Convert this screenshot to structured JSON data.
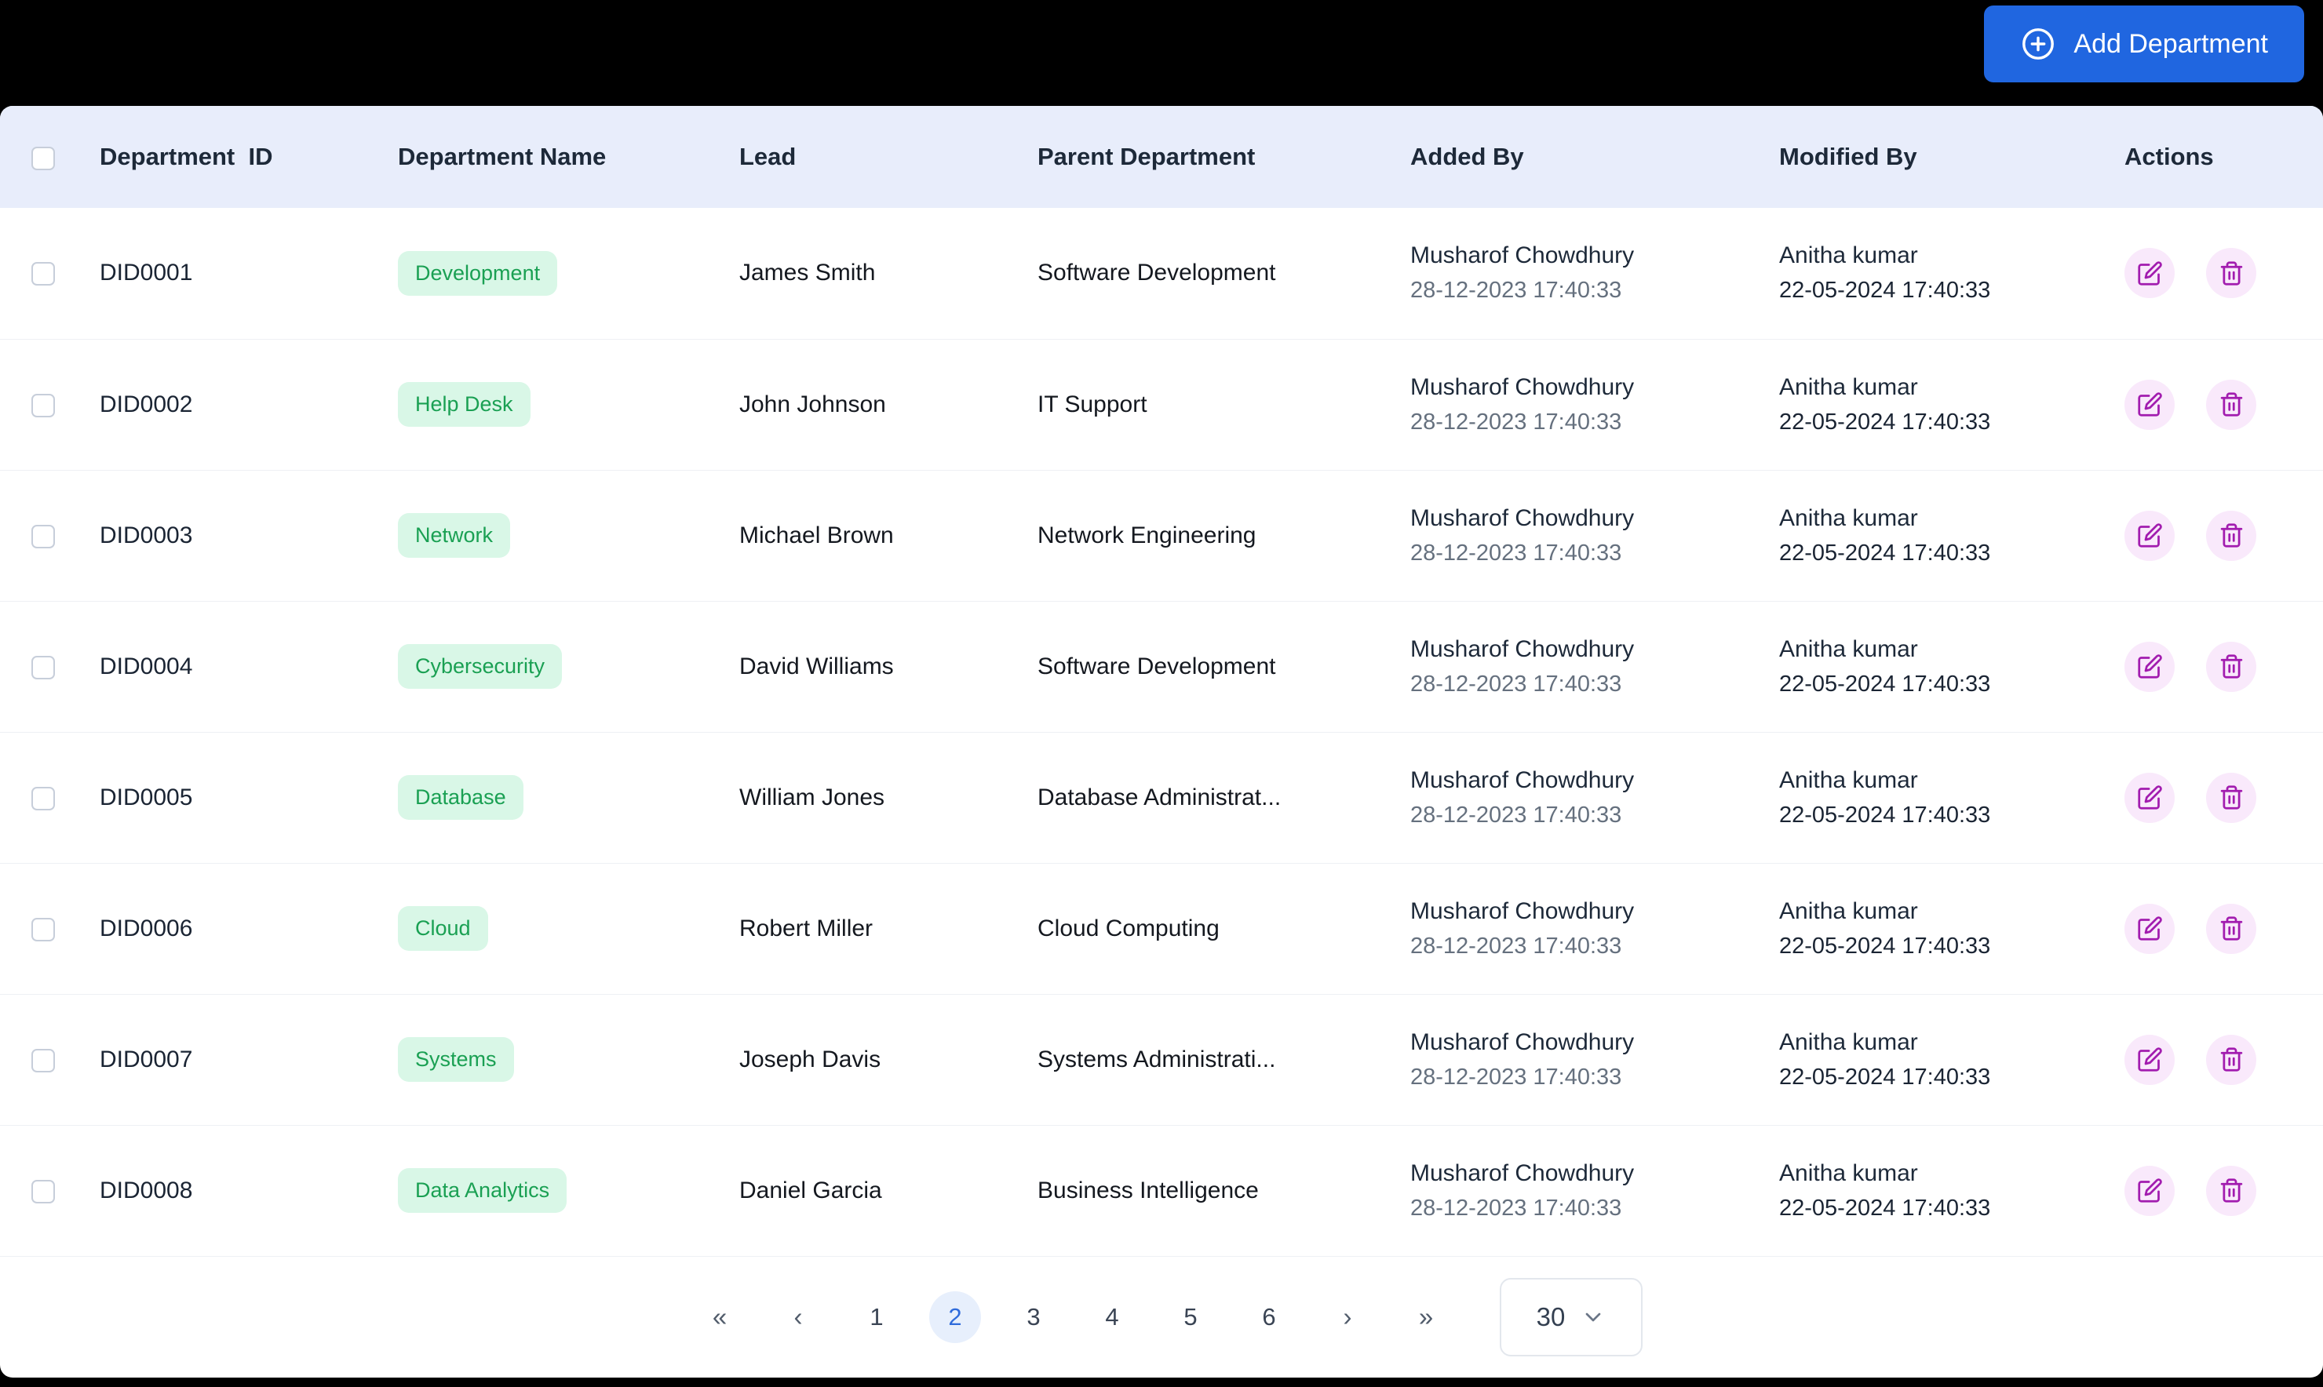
{
  "topbar": {
    "add_button_label": "Add Department"
  },
  "colors": {
    "accent_blue": "#2066e0",
    "header_bg": "#e8edfb",
    "badge_bg": "#d9f7e7",
    "badge_text": "#1aa053",
    "action_icon": "#a21caf",
    "action_circle_bg": "#f9e9fb",
    "active_page_bg": "#e7effc",
    "active_page_text": "#2f6bdb"
  },
  "table": {
    "headers": {
      "department_id": "Department  ID",
      "department_name": "Department Name",
      "lead": "Lead",
      "parent_department": "Parent Department",
      "added_by": "Added By",
      "modified_by": "Modified By",
      "actions": "Actions"
    },
    "rows": [
      {
        "id": "DID0001",
        "name": "Development",
        "lead": "James Smith",
        "parent": "Software Development",
        "added_by": "Musharof Chowdhury",
        "added_at": "28-12-2023 17:40:33",
        "modified_by": "Anitha kumar",
        "modified_at": "22-05-2024 17:40:33"
      },
      {
        "id": "DID0002",
        "name": "Help Desk",
        "lead": "John Johnson",
        "parent": "IT Support",
        "added_by": "Musharof Chowdhury",
        "added_at": "28-12-2023 17:40:33",
        "modified_by": "Anitha kumar",
        "modified_at": "22-05-2024 17:40:33"
      },
      {
        "id": "DID0003",
        "name": "Network",
        "lead": "Michael Brown",
        "parent": "Network Engineering",
        "added_by": "Musharof Chowdhury",
        "added_at": "28-12-2023 17:40:33",
        "modified_by": "Anitha kumar",
        "modified_at": "22-05-2024 17:40:33"
      },
      {
        "id": "DID0004",
        "name": "Cybersecurity",
        "lead": "David Williams",
        "parent": "Software Development",
        "added_by": "Musharof Chowdhury",
        "added_at": "28-12-2023 17:40:33",
        "modified_by": "Anitha kumar",
        "modified_at": "22-05-2024 17:40:33"
      },
      {
        "id": "DID0005",
        "name": "Database",
        "lead": "William Jones",
        "parent": "Database Administrat...",
        "added_by": "Musharof Chowdhury",
        "added_at": "28-12-2023 17:40:33",
        "modified_by": "Anitha kumar",
        "modified_at": "22-05-2024 17:40:33"
      },
      {
        "id": "DID0006",
        "name": "Cloud",
        "lead": "Robert Miller",
        "parent": "Cloud Computing",
        "added_by": "Musharof Chowdhury",
        "added_at": "28-12-2023 17:40:33",
        "modified_by": "Anitha kumar",
        "modified_at": "22-05-2024 17:40:33"
      },
      {
        "id": "DID0007",
        "name": "Systems",
        "lead": "Joseph Davis",
        "parent": "Systems Administrati...",
        "added_by": "Musharof Chowdhury",
        "added_at": "28-12-2023 17:40:33",
        "modified_by": "Anitha kumar",
        "modified_at": "22-05-2024 17:40:33"
      },
      {
        "id": "DID0008",
        "name": "Data Analytics",
        "lead": "Daniel Garcia",
        "parent": "Business Intelligence",
        "added_by": "Musharof Chowdhury",
        "added_at": "28-12-2023 17:40:33",
        "modified_by": "Anitha kumar",
        "modified_at": "22-05-2024 17:40:33"
      }
    ]
  },
  "pagination": {
    "first": "«",
    "prev": "‹",
    "pages": [
      "1",
      "2",
      "3",
      "4",
      "5",
      "6"
    ],
    "active_page": "2",
    "next": "›",
    "last": "»",
    "page_size": "30"
  }
}
